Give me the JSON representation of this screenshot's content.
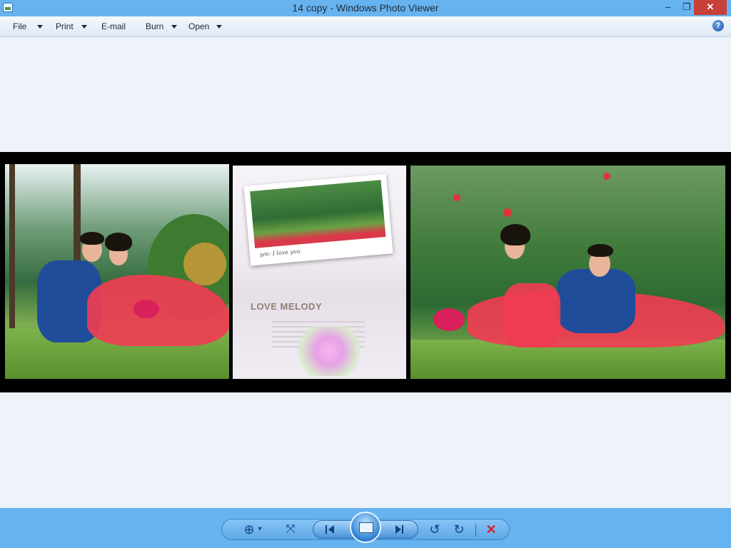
{
  "window": {
    "title": "14 copy - Windows Photo Viewer",
    "minimize_glyph": "–",
    "maximize_glyph": "❐",
    "close_glyph": "✕"
  },
  "menu": {
    "items": [
      {
        "label": "File",
        "has_dropdown": true
      },
      {
        "label": "Print",
        "has_dropdown": true
      },
      {
        "label": "E-mail",
        "has_dropdown": false
      },
      {
        "label": "Burn",
        "has_dropdown": true
      },
      {
        "label": "Open",
        "has_dropdown": true
      }
    ],
    "help_glyph": "?"
  },
  "photo": {
    "polaroid_caption": "p/e: I love you",
    "center_heading": "LOVE MELODY"
  },
  "toolbar": {
    "zoom_glyph": "⊕",
    "zoom_dropdown_glyph": "▾",
    "fit_glyph": "⤧",
    "rotate_ccw_glyph": "↺",
    "rotate_cw_glyph": "↻",
    "delete_glyph": "✕"
  },
  "colors": {
    "chrome": "#67b3f0",
    "close_button": "#c7403a",
    "delete_icon": "#d0202a",
    "background": "#eef2f9"
  }
}
